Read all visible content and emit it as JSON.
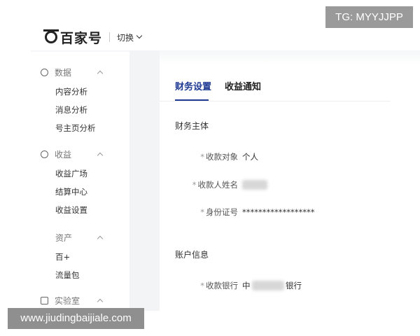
{
  "watermarks": {
    "top": "TG: MYYJJPP",
    "bottom": "www.jiudingbaijiale.com"
  },
  "header": {
    "brand": "百家号",
    "switch_label": "切换"
  },
  "sidebar": {
    "data_section": {
      "label": "数据",
      "items": [
        "内容分析",
        "消息分析",
        "号主页分析"
      ]
    },
    "income_section": {
      "label": "收益",
      "items": [
        "收益广场",
        "结算中心",
        "收益设置"
      ]
    },
    "assets_section": {
      "label": "资产",
      "items": [
        "百+",
        "流量包"
      ]
    },
    "lab_section": {
      "label": "实验室"
    }
  },
  "main": {
    "tabs": [
      "财务设置",
      "收益通知"
    ],
    "active_tab": "财务设置",
    "finance_subject": {
      "title": "财务主体",
      "fields": [
        {
          "label": "收款对象",
          "value": "个人"
        },
        {
          "label": "收款人姓名",
          "value": ""
        },
        {
          "label": "身份证号",
          "value": "******************"
        }
      ]
    },
    "account_info": {
      "title": "账户信息",
      "fields": [
        {
          "label": "收款银行",
          "value_prefix": "中",
          "value_suffix": "银行"
        }
      ]
    }
  },
  "colors": {
    "accent": "#1f3a93",
    "sidebar_gap": "#f3f4f6"
  }
}
